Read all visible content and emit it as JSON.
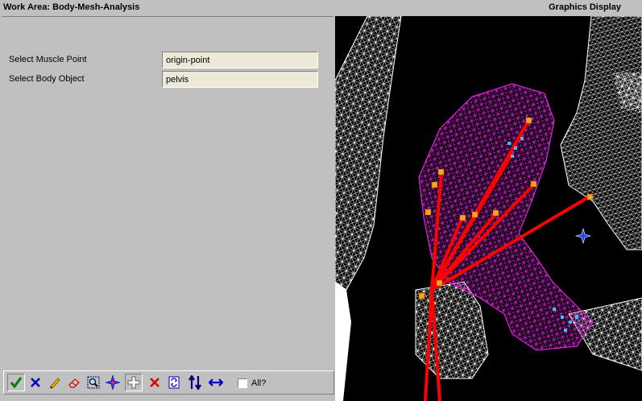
{
  "title_bar": {
    "work_area_title": "Work Area: Body-Mesh-Analysis",
    "graphics_title": "Graphics Display"
  },
  "form": {
    "muscle_point": {
      "label": "Select Muscle Point",
      "value": "origin-point"
    },
    "body_object": {
      "label": "Select Body Object",
      "value": "pelvis"
    }
  },
  "toolbar": {
    "buttons": [
      {
        "name": "accept",
        "icon": "check-icon",
        "color": "#008000"
      },
      {
        "name": "cancel",
        "icon": "x-icon",
        "color": "#0000c0"
      },
      {
        "name": "edit",
        "icon": "pencil-icon",
        "color": "#d4b000"
      },
      {
        "name": "erase",
        "icon": "eraser-icon",
        "color": "#ff8080"
      },
      {
        "name": "zoom-window",
        "icon": "zoom-window-icon",
        "color": "#000080"
      },
      {
        "name": "pick-point",
        "icon": "compass-star-icon",
        "color": "#0000ff"
      },
      {
        "name": "add-point",
        "icon": "plus-icon",
        "color": "#ffffff"
      },
      {
        "name": "delete-point",
        "icon": "red-x-icon",
        "color": "#e00000"
      },
      {
        "name": "refresh",
        "icon": "refresh-icon",
        "color": "#0000c0"
      },
      {
        "name": "vertical-move",
        "icon": "up-down-arrows-icon",
        "color": "#000080"
      },
      {
        "name": "horizontal-move",
        "icon": "left-right-arrow-icon",
        "color": "#0000c0"
      }
    ],
    "all_checkbox": {
      "label": "All?",
      "checked": false
    }
  },
  "graphics": {
    "background": "#000000",
    "mesh_color": "#ffffff",
    "pelvis_color": "#e020e0",
    "muscle_line_color": "#ff0000",
    "origin_marker_color": "#ffa020",
    "vertex_marker_color": "#40c0ff",
    "cursor_icon": "compass-star-icon"
  }
}
